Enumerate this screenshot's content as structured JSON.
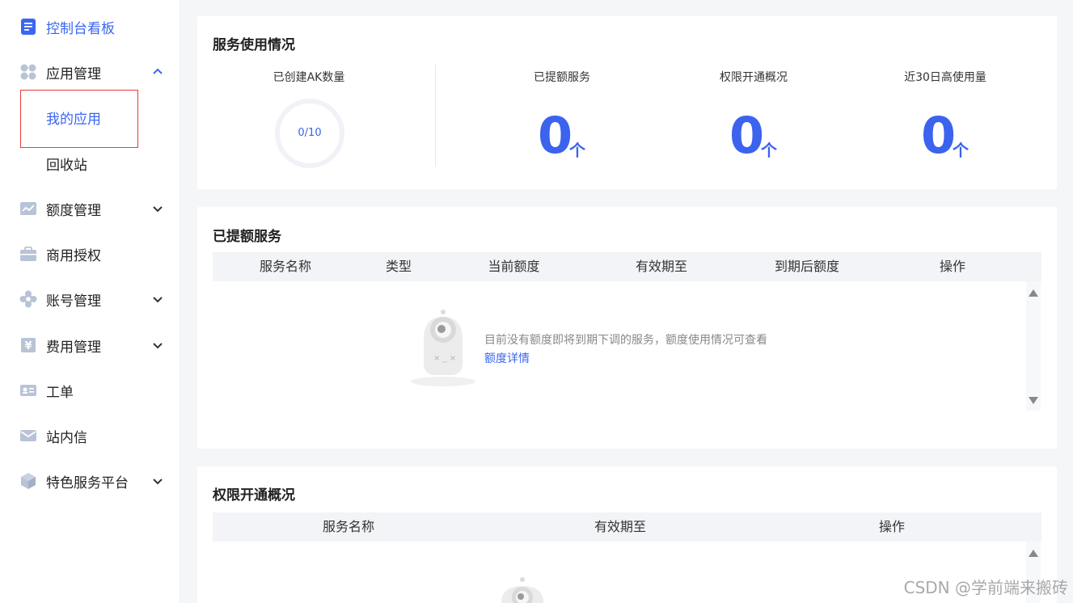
{
  "sidebar": {
    "items": [
      {
        "label": "控制台看板",
        "icon": "document-icon"
      },
      {
        "label": "应用管理",
        "icon": "apps-grid-icon"
      },
      {
        "label": "额度管理",
        "icon": "chart-icon"
      },
      {
        "label": "商用授权",
        "icon": "briefcase-icon"
      },
      {
        "label": "账号管理",
        "icon": "flower-gear-icon"
      },
      {
        "label": "费用管理",
        "icon": "yen-icon"
      },
      {
        "label": "工单",
        "icon": "id-card-icon"
      },
      {
        "label": "站内信",
        "icon": "mail-icon"
      },
      {
        "label": "特色服务平台",
        "icon": "cube-icon"
      }
    ],
    "sub_items": [
      {
        "label": "我的应用"
      },
      {
        "label": "回收站"
      }
    ]
  },
  "usage": {
    "title": "服务使用情况",
    "ak_label": "已创建AK数量",
    "ak_value": "0/10",
    "ak_fraction": 0,
    "stats": [
      {
        "label": "已提额服务",
        "value": "0",
        "unit": "个"
      },
      {
        "label": "权限开通概况",
        "value": "0",
        "unit": "个"
      },
      {
        "label": "近30日高使用量",
        "value": "0",
        "unit": "个"
      }
    ]
  },
  "raised": {
    "title": "已提额服务",
    "columns": [
      "服务名称",
      "类型",
      "当前额度",
      "有效期至",
      "到期后额度",
      "操作"
    ],
    "empty_text": "目前没有额度即将到期下调的服务，额度使用情况可查看",
    "empty_link": "额度详情"
  },
  "permission": {
    "title": "权限开通概况",
    "columns": [
      "服务名称",
      "有效期至",
      "操作"
    ]
  },
  "watermark": "CSDN @学前端来搬砖",
  "colors": {
    "accent": "#3b63ee",
    "highlight_box": "#e83a3a"
  }
}
